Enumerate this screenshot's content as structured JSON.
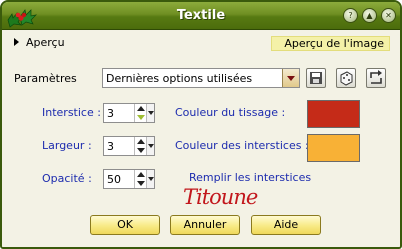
{
  "window": {
    "title": "Textile"
  },
  "preview": {
    "toggle_label": "Aperçu",
    "image_label": "Aperçu de l'image"
  },
  "params": {
    "label": "Paramètres",
    "preset_value": "Dernières options utilisées"
  },
  "interstice": {
    "label": "Interstice :",
    "value": "3"
  },
  "largeur": {
    "label": "Largeur :",
    "value": "3"
  },
  "opacite": {
    "label": "Opacité :",
    "value": "50"
  },
  "colors": {
    "tissage_label": "Couleur du tissage :",
    "tissage_color": "#c52b18",
    "interstices_label": "Couleur des interstices :",
    "interstices_color": "#f8b136"
  },
  "fill": {
    "label": "Remplir les interstices"
  },
  "signature": "Titoune",
  "buttons": {
    "ok": "OK",
    "cancel": "Annuler",
    "help": "Aide"
  },
  "icons": [
    "holly-icon",
    "help-icon",
    "minimize-icon",
    "close-icon",
    "save-preset-icon",
    "random-dice-icon",
    "reset-icon"
  ]
}
